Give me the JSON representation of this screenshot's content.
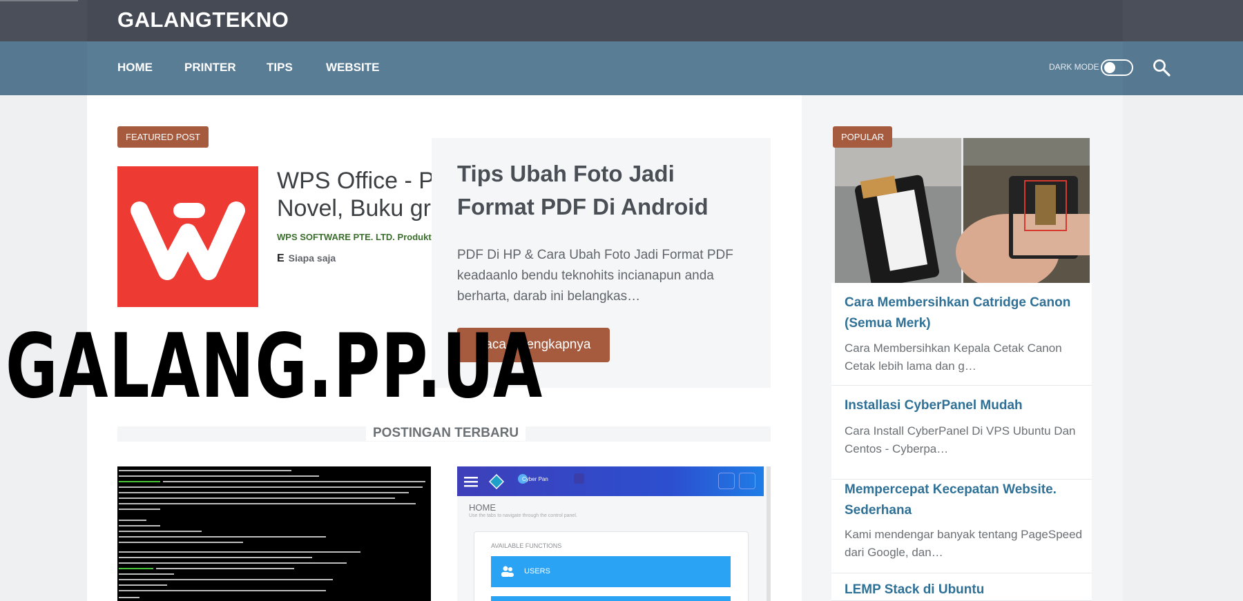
{
  "site": {
    "brand": "GALANGTEKNO",
    "watermark": "GALANG.PP.UA"
  },
  "nav": {
    "items": [
      "HOME",
      "PRINTER",
      "TIPS",
      "WEBSITE"
    ],
    "dark_mode_label": "DARK MODE",
    "dark_mode_on": false
  },
  "featured": {
    "badge": "FEATURED POST",
    "app_title_line1": "WPS Office - PDF,",
    "app_title_line2": "Novel, Buku gratis",
    "app_developer": "WPS SOFTWARE PTE. LTD.   Produktivitas",
    "app_rating_icon": "E",
    "app_rating_text": "Siapa saja",
    "title": "Tips Ubah Foto Jadi Format PDF Di Android",
    "excerpt": "PDF Di HP & Cara Ubah Foto Jadi Format PDF keadaanlo bendu teknohits incianapun anda berharta, darab ini belangkas…",
    "button": "Baca selengkapnya"
  },
  "latest": {
    "heading": "POSTINGAN TERBARU",
    "cp_brand": "Cyber Pan",
    "cp_home": "HOME",
    "cp_sub": "Use the tabs to navigate through the control panel.",
    "cp_available": "AVAILABLE FUNCTIONS",
    "cp_users": "USERS"
  },
  "sidebar": {
    "badge": "POPULAR",
    "posts": [
      {
        "title": "Cara Membersihkan Catridge Canon (Semua Merk)",
        "excerpt": "Cara Membersihkan Kepala Cetak Canon Cetak lebih lama dan g…"
      },
      {
        "title": "Installasi CyberPanel Mudah",
        "excerpt": "Cara Install CyberPanel Di VPS Ubuntu Dan Centos - Cyberpa…"
      },
      {
        "title": "Mempercepat Kecepatan Website. Sederhana",
        "excerpt": "Kami mendengar banyak tentang PageSpeed dari Google, dan…"
      },
      {
        "title": "LEMP Stack di Ubuntu",
        "excerpt": ""
      }
    ]
  },
  "colors": {
    "topbar": "#454a54",
    "navbar": "#5a7d96",
    "accent": "#a65a3e",
    "link": "#2f7096"
  },
  "icons": {
    "search": "search-icon",
    "toggle": "toggle-switch"
  }
}
